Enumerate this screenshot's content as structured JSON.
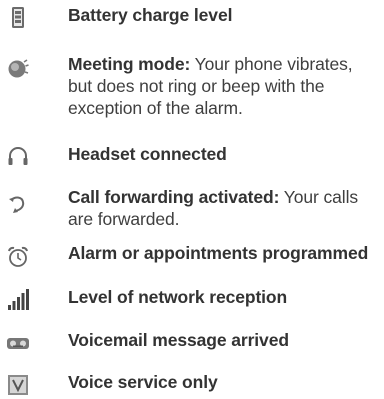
{
  "items": [
    {
      "icon": "battery-charge-icon",
      "title": "Battery charge level",
      "desc": ""
    },
    {
      "icon": "meeting-mode-icon",
      "title": "Meeting mode:",
      "desc": "Your phone vibrates, but does not ring or beep with the exception of the alarm."
    },
    {
      "icon": "headset-icon",
      "title": "Headset connected",
      "desc": ""
    },
    {
      "icon": "call-forward-icon",
      "title": "Call forwarding activated:",
      "desc": "Your calls are forwarded."
    },
    {
      "icon": "alarm-clock-icon",
      "title": "Alarm or appointments programmed",
      "desc": ""
    },
    {
      "icon": "signal-strength-icon",
      "title": "Level of network reception",
      "desc": ""
    },
    {
      "icon": "voicemail-icon",
      "title": "Voicemail message arrived",
      "desc": ""
    },
    {
      "icon": "voice-service-icon",
      "title": "Voice service only",
      "desc": ""
    }
  ]
}
